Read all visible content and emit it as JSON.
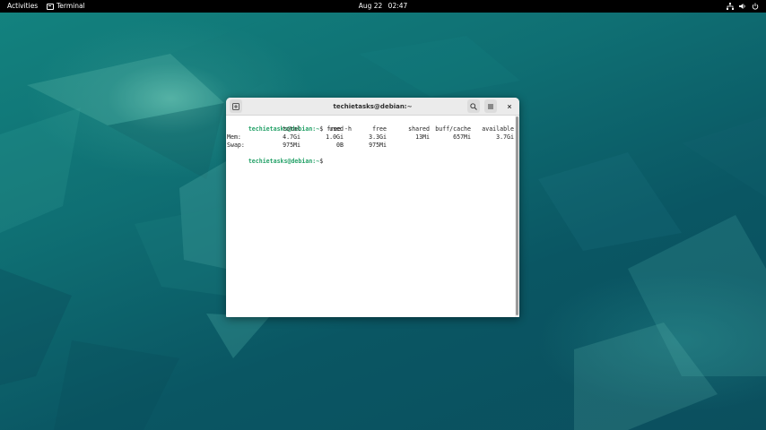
{
  "topbar": {
    "activities": "Activities",
    "app_name": "Terminal",
    "date": "Aug 22",
    "time": "02:47",
    "tray_icons": [
      "network-icon",
      "volume-icon",
      "power-icon"
    ]
  },
  "window": {
    "title": "techietasks@debian:~",
    "buttons": [
      "new-tab-icon",
      "search-icon",
      "menu-icon",
      "close-icon"
    ]
  },
  "terminal": {
    "prompt_user": "techietasks@debian",
    "prompt_path": ":~",
    "prompt_symbol": "$",
    "command": " free -h",
    "headers": [
      "total",
      "used",
      "free",
      "shared",
      "buff/cache",
      "available"
    ],
    "rows": [
      {
        "label": "Mem:",
        "values": [
          "4.7Gi",
          "1.0Gi",
          "3.3Gi",
          "13Mi",
          "657Mi",
          "3.7Gi"
        ]
      },
      {
        "label": "Swap:",
        "values": [
          "975Mi",
          "0B",
          "975Mi",
          "",
          "",
          ""
        ]
      }
    ]
  },
  "colors": {
    "prompt": "#26a269",
    "topbar": "#000000",
    "desktop": "#0b5560"
  }
}
